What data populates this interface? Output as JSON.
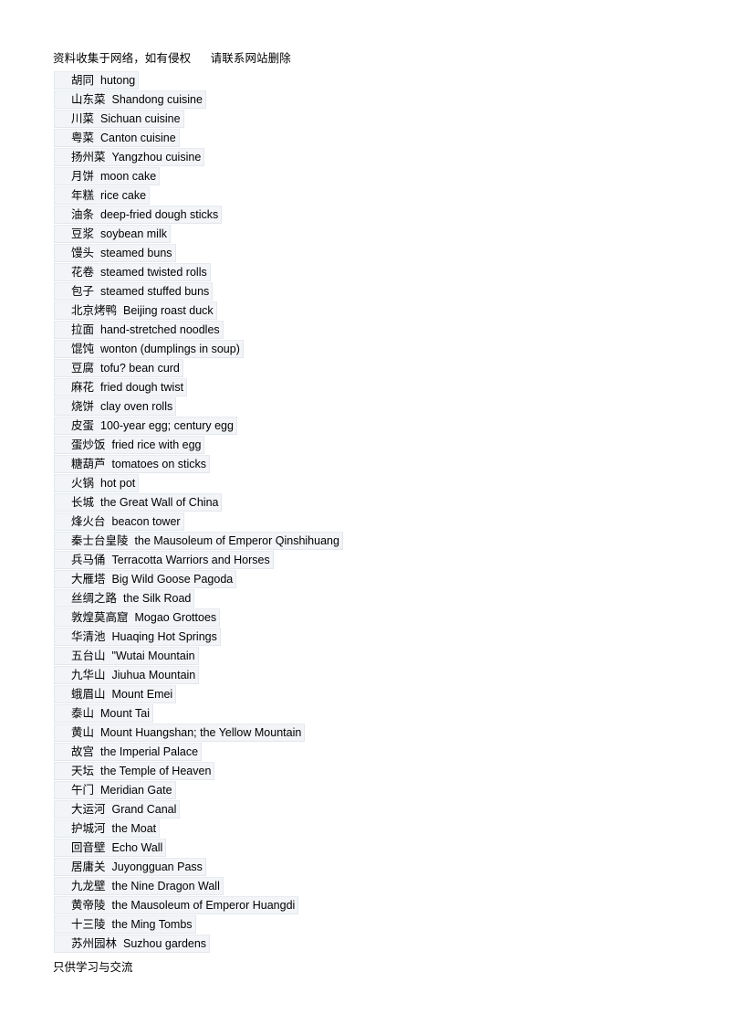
{
  "document": {
    "header_note": "资料收集于网络，如有侵权      请联系网站删除",
    "footer_note": "只供学习与交流"
  },
  "glossary": {
    "entries": [
      {
        "term": "胡同",
        "gloss": "hutong"
      },
      {
        "term": "山东菜",
        "gloss": "Shandong cuisine"
      },
      {
        "term": "川菜",
        "gloss": "Sichuan cuisine"
      },
      {
        "term": "粤菜",
        "gloss": "Canton cuisine"
      },
      {
        "term": "扬州菜",
        "gloss": "Yangzhou cuisine"
      },
      {
        "term": "月饼",
        "gloss": "moon cake"
      },
      {
        "term": "年糕",
        "gloss": "rice cake"
      },
      {
        "term": "油条",
        "gloss": "deep-fried dough sticks"
      },
      {
        "term": "豆浆",
        "gloss": "soybean milk"
      },
      {
        "term": "馒头",
        "gloss": "steamed buns"
      },
      {
        "term": "花卷",
        "gloss": "steamed twisted rolls"
      },
      {
        "term": "包子",
        "gloss": "steamed stuffed buns"
      },
      {
        "term": "北京烤鸭",
        "gloss": "Beijing roast duck"
      },
      {
        "term": "拉面",
        "gloss": "hand-stretched noodles"
      },
      {
        "term": "馄饨",
        "gloss": "wonton (dumplings in soup)"
      },
      {
        "term": "豆腐",
        "gloss": "tofu? bean curd"
      },
      {
        "term": "麻花",
        "gloss": "fried dough twist"
      },
      {
        "term": "烧饼",
        "gloss": "clay oven rolls"
      },
      {
        "term": "皮蛋",
        "gloss": "100-year egg; century egg"
      },
      {
        "term": "蛋炒饭",
        "gloss": "fried rice with egg"
      },
      {
        "term": "糖葫芦",
        "gloss": "tomatoes on sticks"
      },
      {
        "term": "火锅",
        "gloss": "hot pot"
      },
      {
        "term": "长城",
        "gloss": "the Great Wall of China"
      },
      {
        "term": "烽火台",
        "gloss": "beacon tower"
      },
      {
        "term": "秦士台皇陵",
        "gloss": "the Mausoleum of Emperor Qinshihuang"
      },
      {
        "term": "兵马俑",
        "gloss": "Terracotta Warriors and Horses"
      },
      {
        "term": "大雁塔",
        "gloss": "Big Wild Goose Pagoda"
      },
      {
        "term": "丝绸之路",
        "gloss": "the Silk Road"
      },
      {
        "term": "敦煌莫高窟",
        "gloss": "Mogao Grottoes"
      },
      {
        "term": "华清池",
        "gloss": "Huaqing Hot Springs"
      },
      {
        "term": "五台山",
        "gloss": "\"Wutai Mountain"
      },
      {
        "term": "九华山",
        "gloss": "Jiuhua Mountain"
      },
      {
        "term": "蛾眉山",
        "gloss": "Mount Emei"
      },
      {
        "term": "泰山",
        "gloss": "Mount Tai"
      },
      {
        "term": "黄山",
        "gloss": "Mount Huangshan; the Yellow Mountain"
      },
      {
        "term": "故宫",
        "gloss": "the Imperial Palace"
      },
      {
        "term": "天坛",
        "gloss": "the Temple of Heaven"
      },
      {
        "term": "午门",
        "gloss": "Meridian Gate"
      },
      {
        "term": "大运河",
        "gloss": "Grand Canal"
      },
      {
        "term": "护城河",
        "gloss": "the Moat"
      },
      {
        "term": "回音壁",
        "gloss": "Echo Wall"
      },
      {
        "term": "居庸关",
        "gloss": "Juyongguan Pass"
      },
      {
        "term": "九龙壁",
        "gloss": "the Nine Dragon Wall"
      },
      {
        "term": "黄帝陵",
        "gloss": "the Mausoleum of Emperor Huangdi"
      },
      {
        "term": "十三陵",
        "gloss": "the Ming Tombs"
      },
      {
        "term": "苏州园林",
        "gloss": "Suzhou gardens"
      }
    ]
  }
}
